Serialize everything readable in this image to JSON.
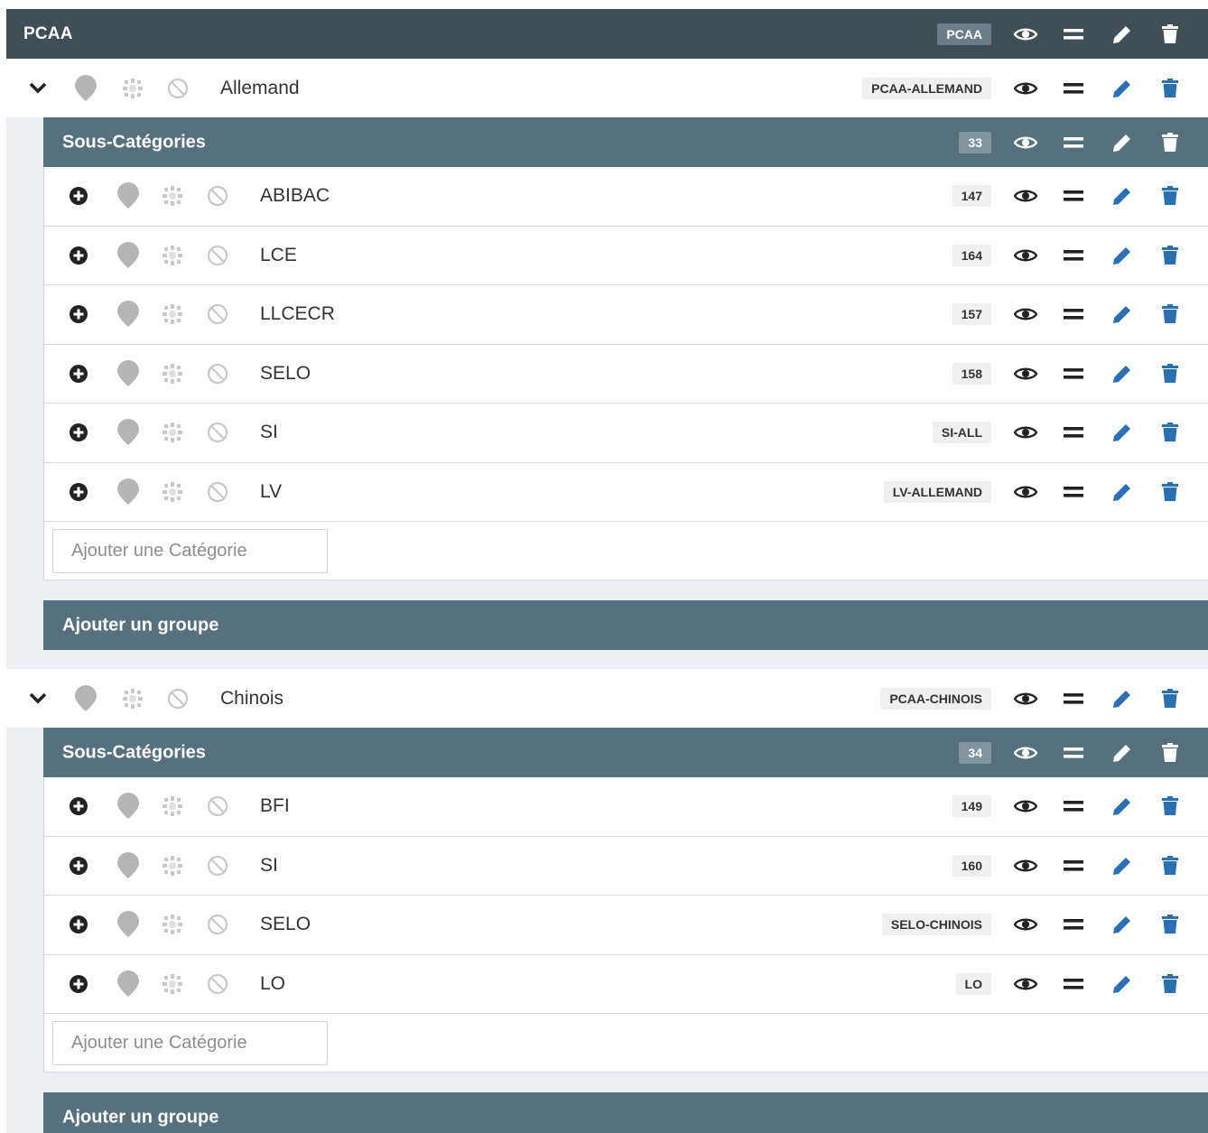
{
  "root": {
    "title": "PCAA",
    "badge": "PCAA"
  },
  "groups": [
    {
      "name": "Allemand",
      "code": "PCAA-ALLEMAND",
      "subcategories": {
        "title": "Sous-Catégories",
        "count": "33",
        "items": [
          {
            "name": "ABIBAC",
            "code": "147"
          },
          {
            "name": "LCE",
            "code": "164"
          },
          {
            "name": "LLCECR",
            "code": "157"
          },
          {
            "name": "SELO",
            "code": "158"
          },
          {
            "name": "SI",
            "code": "SI-ALL"
          },
          {
            "name": "LV",
            "code": "LV-ALLEMAND"
          }
        ],
        "add_placeholder": "Ajouter une Catégorie"
      },
      "add_group_label": "Ajouter un groupe"
    },
    {
      "name": "Chinois",
      "code": "PCAA-CHINOIS",
      "subcategories": {
        "title": "Sous-Catégories",
        "count": "34",
        "items": [
          {
            "name": "BFI",
            "code": "149"
          },
          {
            "name": "SI",
            "code": "160"
          },
          {
            "name": "SELO",
            "code": "SELO-CHINOIS"
          },
          {
            "name": "LO",
            "code": "LO"
          }
        ],
        "add_placeholder": "Ajouter une Catégorie"
      },
      "add_group_label": "Ajouter un groupe"
    }
  ],
  "icons": {
    "eye": "eye-icon",
    "reorder": "equals-icon",
    "edit": "pencil-icon",
    "delete": "trash-icon",
    "expand": "chevron-down-icon",
    "add": "plus-circle-icon",
    "marker": "map-marker-icon",
    "settings": "cog-icon",
    "block": "ban-icon"
  },
  "colors": {
    "top_header": "#3f4e57",
    "sub_header": "#57707d",
    "accent_blue": "#2b6fb3",
    "icon_grey": "#b5b5b5",
    "panel_bg": "#ebeff3"
  }
}
